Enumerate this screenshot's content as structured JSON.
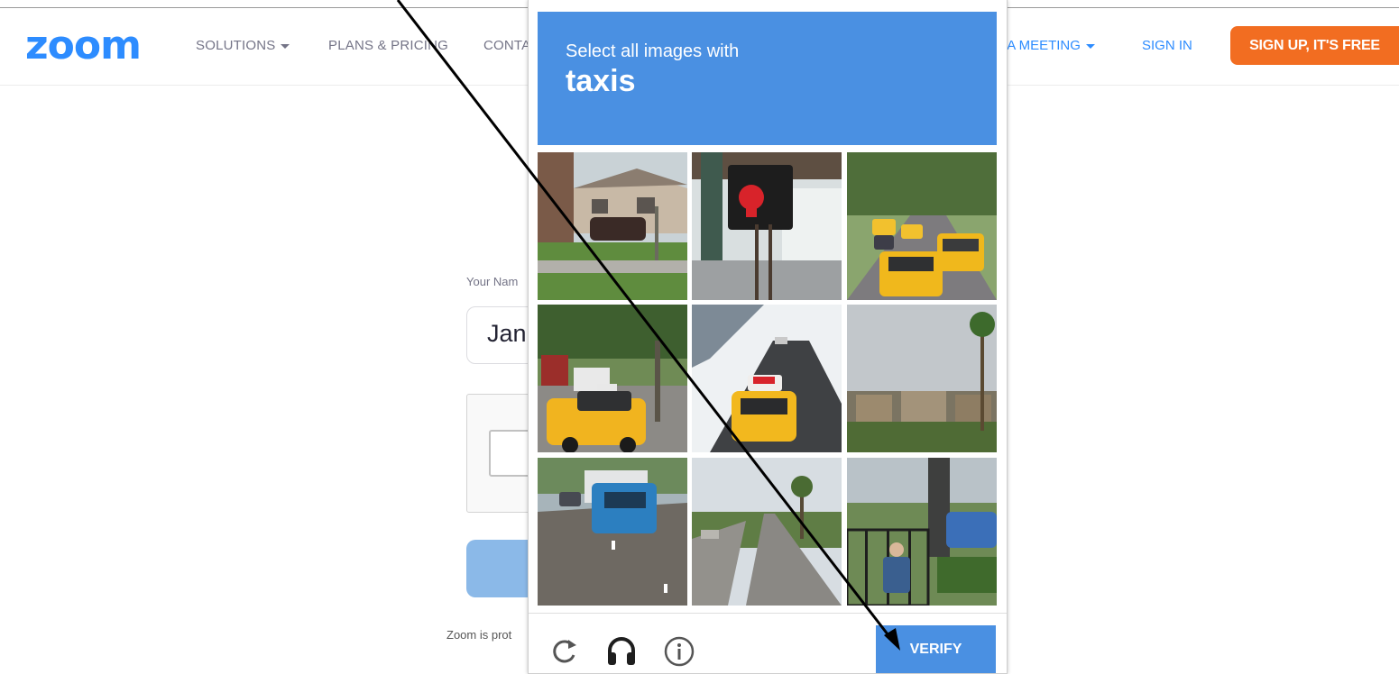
{
  "header": {
    "logo": "zoom",
    "nav": [
      {
        "label": "SOLUTIONS",
        "has_caret": true
      },
      {
        "label": "PLANS & PRICING",
        "has_caret": false
      },
      {
        "label": "CONTA",
        "has_caret": false
      }
    ],
    "host_meeting_partial": "T A MEETING",
    "sign_in": "SIGN IN",
    "sign_up": "SIGN UP, IT'S FREE"
  },
  "form": {
    "name_label": "Your Nam",
    "name_value": "Jan",
    "footer_text": "Zoom is prot"
  },
  "captcha": {
    "instruction": "Select all images with",
    "target": "taxis",
    "verify_label": "VERIFY",
    "tiles": [
      {
        "scene": "house-street"
      },
      {
        "scene": "pedestrian-signal"
      },
      {
        "scene": "taxis-traffic"
      },
      {
        "scene": "taxi-intersection"
      },
      {
        "scene": "taxi-road"
      },
      {
        "scene": "palm-buildings"
      },
      {
        "scene": "truck-highway"
      },
      {
        "scene": "palm-street"
      },
      {
        "scene": "person-fence"
      }
    ],
    "footer_icons": [
      "reload-icon",
      "audio-icon",
      "info-icon"
    ]
  },
  "colors": {
    "brand": "#2d8cff",
    "signup": "#f26d21",
    "captcha_blue": "#4a90e2"
  }
}
